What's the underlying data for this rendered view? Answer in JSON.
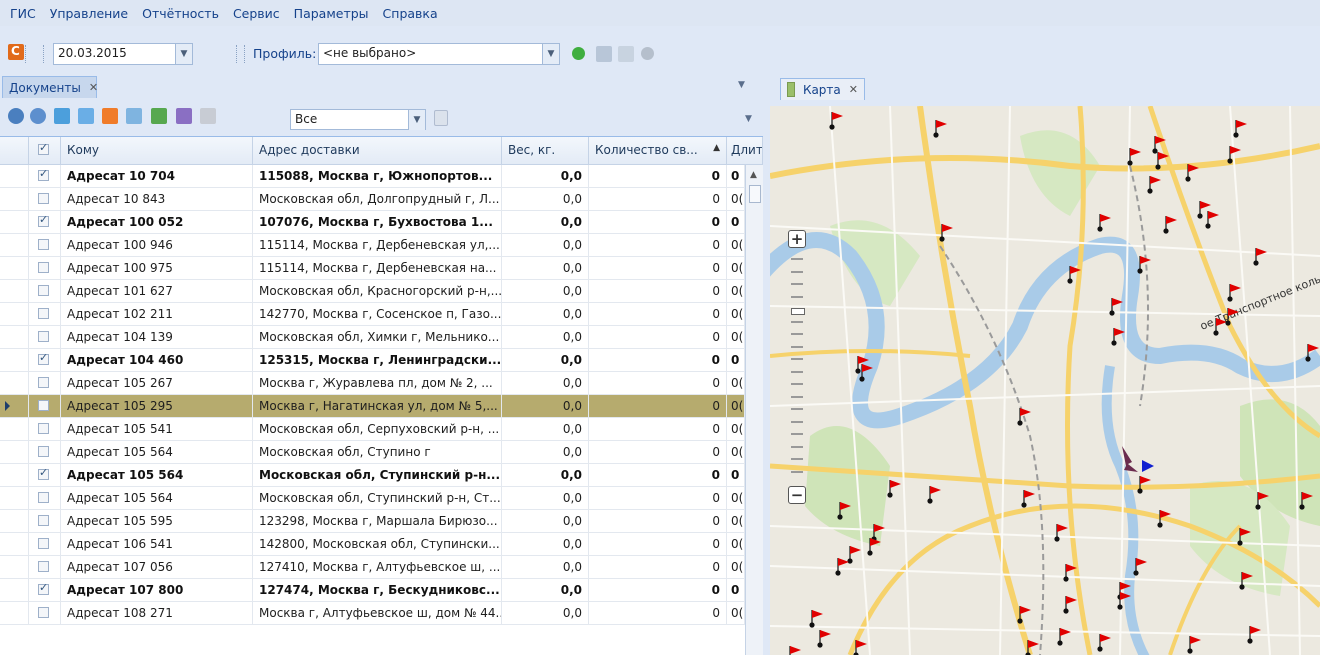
{
  "menu": [
    "ГИС",
    "Управление",
    "Отчётность",
    "Сервис",
    "Параметры",
    "Справка"
  ],
  "toolbar": {
    "date": "20.03.2015",
    "profile_label": "Профиль:",
    "profile_value": "<не выбрано>"
  },
  "documents_panel": {
    "tab_label": "Документы",
    "filter_value": "Все",
    "columns": [
      "Кому",
      "Адрес доставки",
      "Вес, кг.",
      "Количество св...",
      "Длит"
    ],
    "rows": [
      {
        "to": "Адресат 10 704",
        "address": "115088, Москва г, Южнопортов...",
        "weight": "0,0",
        "count": "0",
        "dur": "0",
        "checked": true,
        "bold": true
      },
      {
        "to": "Адресат 10 843",
        "address": "Московская обл, Долгопрудный г, Л...",
        "weight": "0,0",
        "count": "0",
        "dur": "0(",
        "checked": false,
        "bold": false
      },
      {
        "to": "Адресат 100 052",
        "address": "107076, Москва г, Бухвостова 1...",
        "weight": "0,0",
        "count": "0",
        "dur": "0",
        "checked": true,
        "bold": true
      },
      {
        "to": "Адресат 100 946",
        "address": "115114, Москва г, Дербеневская ул,...",
        "weight": "0,0",
        "count": "0",
        "dur": "0(",
        "checked": false,
        "bold": false
      },
      {
        "to": "Адресат 100 975",
        "address": "115114, Москва г, Дербеневская на...",
        "weight": "0,0",
        "count": "0",
        "dur": "0(",
        "checked": false,
        "bold": false
      },
      {
        "to": "Адресат 101 627",
        "address": "Московская обл, Красногорский р-н,...",
        "weight": "0,0",
        "count": "0",
        "dur": "0(",
        "checked": false,
        "bold": false
      },
      {
        "to": "Адресат 102 211",
        "address": "142770, Москва г, Сосенское п, Газо...",
        "weight": "0,0",
        "count": "0",
        "dur": "0(",
        "checked": false,
        "bold": false
      },
      {
        "to": "Адресат 104 139",
        "address": "Московская обл, Химки г, Мельнико...",
        "weight": "0,0",
        "count": "0",
        "dur": "0(",
        "checked": false,
        "bold": false
      },
      {
        "to": "Адресат 104 460",
        "address": "125315, Москва г, Ленинградски...",
        "weight": "0,0",
        "count": "0",
        "dur": "0",
        "checked": true,
        "bold": true
      },
      {
        "to": "Адресат 105 267",
        "address": "Москва г, Журавлева пл, дом № 2, ...",
        "weight": "0,0",
        "count": "0",
        "dur": "0(",
        "checked": false,
        "bold": false
      },
      {
        "to": "Адресат 105 295",
        "address": "Москва г, Нагатинская ул, дом № 5,...",
        "weight": "0,0",
        "count": "0",
        "dur": "0(",
        "checked": false,
        "bold": false,
        "selected": true
      },
      {
        "to": "Адресат 105 541",
        "address": "Московская обл, Серпуховский р-н, ...",
        "weight": "0,0",
        "count": "0",
        "dur": "0(",
        "checked": false,
        "bold": false
      },
      {
        "to": "Адресат 105 564",
        "address": "Московская обл, Ступино г",
        "weight": "0,0",
        "count": "0",
        "dur": "0(",
        "checked": false,
        "bold": false
      },
      {
        "to": "Адресат 105 564",
        "address": "Московская обл, Ступинский р-н...",
        "weight": "0,0",
        "count": "0",
        "dur": "0",
        "checked": true,
        "bold": true
      },
      {
        "to": "Адресат 105 564",
        "address": "Московская обл, Ступинский р-н, Ст...",
        "weight": "0,0",
        "count": "0",
        "dur": "0(",
        "checked": false,
        "bold": false
      },
      {
        "to": "Адресат 105 595",
        "address": "123298, Москва г, Маршала Бирюзо...",
        "weight": "0,0",
        "count": "0",
        "dur": "0(",
        "checked": false,
        "bold": false
      },
      {
        "to": "Адресат 106 541",
        "address": "142800, Московская обл, Ступински...",
        "weight": "0,0",
        "count": "0",
        "dur": "0(",
        "checked": false,
        "bold": false
      },
      {
        "to": "Адресат 107 056",
        "address": "127410, Москва г, Алтуфьевское ш, ...",
        "weight": "0,0",
        "count": "0",
        "dur": "0(",
        "checked": false,
        "bold": false
      },
      {
        "to": "Адресат 107 800",
        "address": "127474, Москва г, Бескудниковс...",
        "weight": "0,0",
        "count": "0",
        "dur": "0",
        "checked": true,
        "bold": true
      },
      {
        "to": "Адресат 108 271",
        "address": "Москва г, Алтуфьевское ш, дом № 44...",
        "weight": "0,0",
        "count": "0",
        "dur": "0(",
        "checked": false,
        "bold": false
      }
    ]
  },
  "map_panel": {
    "tab_label": "Карта",
    "road_label": "ое Транспортное коль"
  },
  "colors": {
    "accent": "#15428b",
    "selected_row": "#b6ab6e",
    "marker_flag": "#e00000",
    "water": "#a9cbe8",
    "park": "#cbe3b4",
    "road": "#f6d26b"
  }
}
